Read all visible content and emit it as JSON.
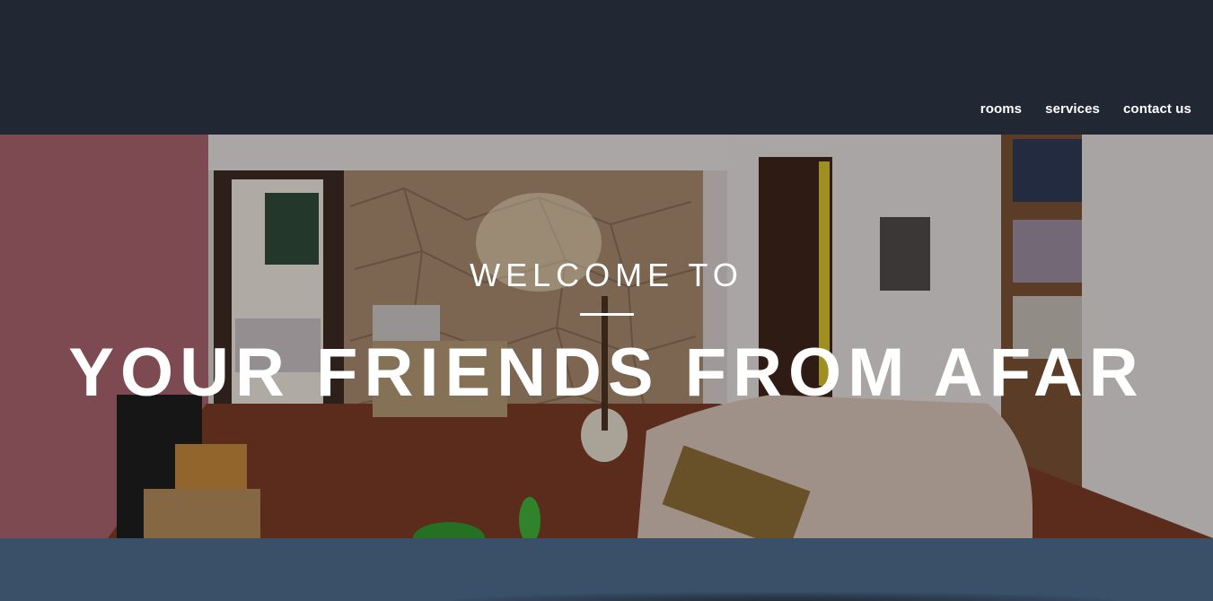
{
  "nav": {
    "items": [
      {
        "label": "rooms"
      },
      {
        "label": "services"
      },
      {
        "label": "contact us"
      }
    ]
  },
  "hero": {
    "kicker": "WELCOME TO",
    "title": "YOUR FRIENDS FROM AFAR"
  },
  "colors": {
    "header_bg": "#212733",
    "band_bg": "#3a5068",
    "text": "#ffffff"
  }
}
